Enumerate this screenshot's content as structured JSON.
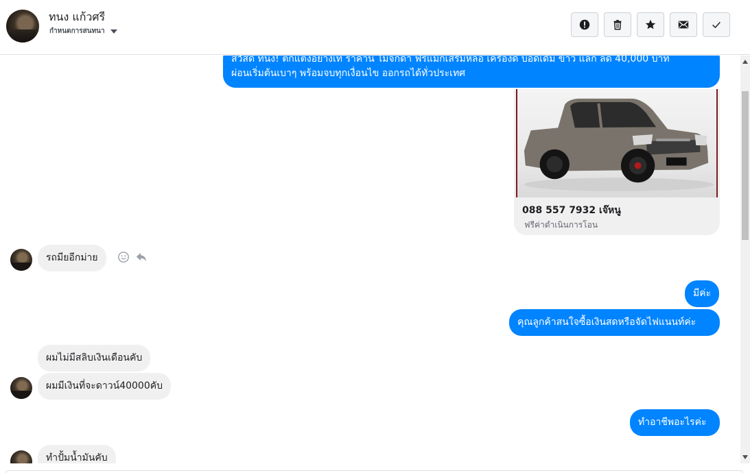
{
  "header": {
    "contact_name": "ทนง แก้วศรี",
    "subtitle": "กำหนดการสนทนา",
    "actions": [
      {
        "name": "spam-button",
        "icon": "exclamation-icon"
      },
      {
        "name": "delete-button",
        "icon": "trash-icon"
      },
      {
        "name": "star-button",
        "icon": "star-icon"
      },
      {
        "name": "mark-unread-button",
        "icon": "envelope-icon"
      },
      {
        "name": "mark-done-button",
        "icon": "check-icon"
      }
    ]
  },
  "conversation": {
    "outgoing_intro_line1": "สวัสดี ทนง! ตกแต่งอย่างเท่ ราคาน ไม่จกดา ฟรีแม็กเสริมหล่อ เครื่องดี บอดี้เดิม ข้าว แลก ลด 40,000 บาท",
    "outgoing_intro_line2": "ผ่อนเริ่มต้นเบาๆ พร้อมจบทุกเงื่อนไข ออกรถได้ทั่วประเทศ",
    "card": {
      "title": "088 557 7932 เจ๊หนู",
      "subtitle": "ฟรีค่าดำเนินการโอน"
    },
    "incoming_1": "รถมียอีกม่าย",
    "outgoing_2": "มีค่ะ",
    "outgoing_3": "คุณลูกค้าสนใจซื้อเงินสดหรือจัดไฟแนนท์ค่ะ",
    "incoming_2": "ผมไม่มีสลิบเงินเดือนคับ",
    "incoming_3": "ผมมีเงินที่จะดาวน์40000คับ",
    "outgoing_4": "ทำอาชีพอะไรค่ะ",
    "incoming_4": "ทำปั้มน้ำมันคับ"
  },
  "colors": {
    "outgoing_bubble": "#0084ff",
    "incoming_bubble": "#f1f0f0"
  }
}
